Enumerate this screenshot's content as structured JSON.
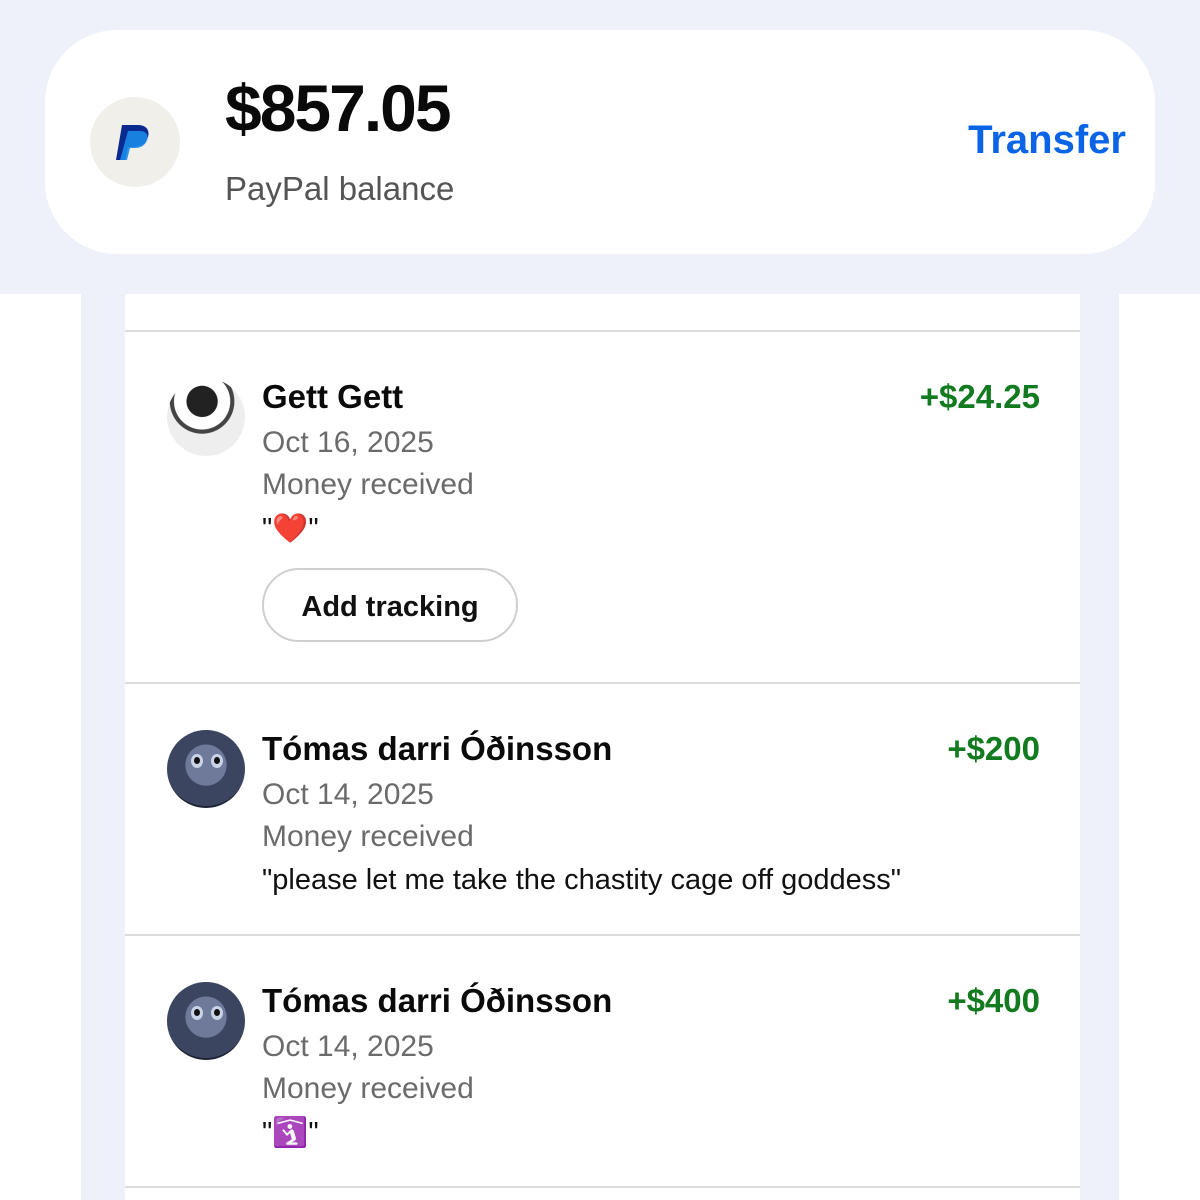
{
  "balance": {
    "amount": "$857.05",
    "label": "PayPal balance",
    "transfer_label": "Transfer",
    "logo_icon": "paypal-logo"
  },
  "colors": {
    "accent": "#0b63e6",
    "positive_amount": "#127a1f",
    "band_background": "#eef1fa"
  },
  "transactions": [
    {
      "name": "Gett Gett",
      "date": "Oct 16, 2025",
      "status": "Money received",
      "amount": "+$24.25",
      "note_open": "\"",
      "note_emoji": "❤️",
      "note_close": "\"",
      "action_label": "Add tracking"
    },
    {
      "name": "Tómas darri Óðinsson",
      "date": "Oct 14, 2025",
      "status": "Money received",
      "amount": "+$200",
      "note": "\"please let me take the chastity cage off goddess\""
    },
    {
      "name": "Tómas darri Óðinsson",
      "date": "Oct 14, 2025",
      "status": "Money received",
      "amount": "+$400",
      "note_open": "\"",
      "note_emoji": "🛐",
      "note_close": "\""
    }
  ]
}
